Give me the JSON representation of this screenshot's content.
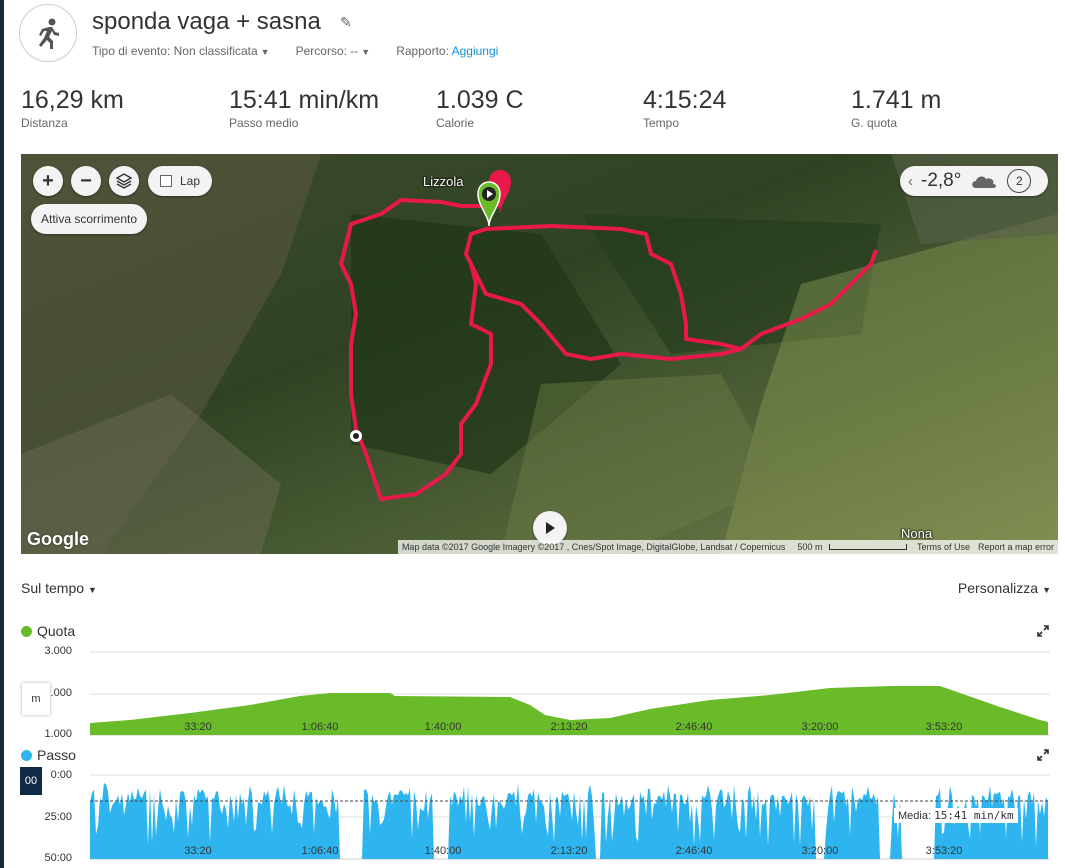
{
  "activity": {
    "title": "sponda vaga + sasna",
    "icon": "running-person-icon"
  },
  "meta": {
    "event_type_label": "Tipo di evento:",
    "event_type_value": "Non classificata",
    "course_label": "Percorso:",
    "course_value": "--",
    "report_label": "Rapporto:",
    "report_link": "Aggiungi"
  },
  "stats": [
    {
      "value": "16,29 km",
      "label": "Distanza"
    },
    {
      "value": "15:41 min/km",
      "label": "Passo medio"
    },
    {
      "value": "1.039 C",
      "label": "Calorie"
    },
    {
      "value": "4:15:24",
      "label": "Tempo"
    },
    {
      "value": "1.741 m",
      "label": "G. quota"
    }
  ],
  "map": {
    "zoom_in": "+",
    "zoom_out": "−",
    "lap_label": "Lap",
    "scroll_button": "Attiva scorrimento",
    "weather_temp": "-2,8°",
    "weather_num": "2",
    "place_lizzola": "Lizzola",
    "place_nona": "Nona",
    "google": "Google",
    "attribution": "Map data ©2017 Google Imagery ©2017 , Cnes/Spot Image, DigitalGlobe, Landsat / Copernicus",
    "scale": "500 m",
    "terms": "Terms of Use",
    "report_error": "Report a map error",
    "route_color": "#e8194a"
  },
  "controls": {
    "time_axis": "Sul tempo",
    "customize": "Personalizza"
  },
  "charts": {
    "elevation": {
      "title": "Quota",
      "color": "#6abb2a",
      "yticks": [
        "3.000",
        "2.000",
        "1.000"
      ],
      "unit": "m",
      "xticks": [
        "33:20",
        "1:06:40",
        "1:40:00",
        "2:13:20",
        "2:46:40",
        "3:20:00",
        "3:53:20"
      ]
    },
    "pace": {
      "title": "Passo",
      "color": "#2eb5ef",
      "yticks": [
        "0:00",
        "25:00",
        "50:00"
      ],
      "dark_box": "00",
      "avg_label": "Media:",
      "avg_value": "15:41 min/km",
      "xticks": [
        "33:20",
        "1:06:40",
        "1:40:00",
        "2:13:20",
        "2:46:40",
        "3:20:00",
        "3:53:20"
      ]
    }
  }
}
